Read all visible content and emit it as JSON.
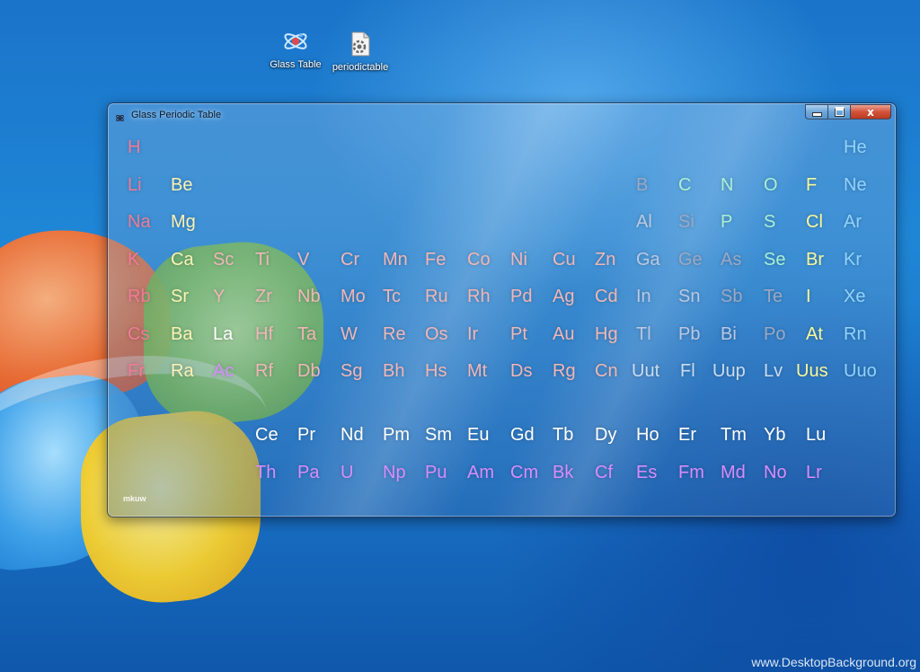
{
  "desktop": {
    "icons": [
      {
        "label": "Glass Table"
      },
      {
        "label": "periodictable"
      }
    ],
    "watermark": "www.DesktopBackground.org"
  },
  "window": {
    "title": "Glass Periodic Table",
    "minimize_symbol": "",
    "close_symbol": "x",
    "footer_mark": "mkuw"
  },
  "colors": {
    "alkali": "#f07a96",
    "alkaline_earth": "#f9f2b4",
    "transition": "#f0b6b6",
    "noble_gas": "#8fd3ff",
    "actinide": "#d78cff",
    "lanthanide": "#ffffff",
    "close_button": "#d2533a"
  },
  "elements": {
    "H": "H",
    "He": "He",
    "Li": "Li",
    "Be": "Be",
    "B": "B",
    "C": "C",
    "N": "N",
    "O": "O",
    "F": "F",
    "Ne": "Ne",
    "Na": "Na",
    "Mg": "Mg",
    "Al": "Al",
    "Si": "Si",
    "P": "P",
    "S": "S",
    "Cl": "Cl",
    "Ar": "Ar",
    "K": "K",
    "Ca": "Ca",
    "Sc": "Sc",
    "Ti": "Ti",
    "V": "V",
    "Cr": "Cr",
    "Mn": "Mn",
    "Fe": "Fe",
    "Co": "Co",
    "Ni": "Ni",
    "Cu": "Cu",
    "Zn": "Zn",
    "Ga": "Ga",
    "Ge": "Ge",
    "As": "As",
    "Se": "Se",
    "Br": "Br",
    "Kr": "Kr",
    "Rb": "Rb",
    "Sr": "Sr",
    "Y": "Y",
    "Zr": "Zr",
    "Nb": "Nb",
    "Mo": "Mo",
    "Tc": "Tc",
    "Ru": "Ru",
    "Rh": "Rh",
    "Pd": "Pd",
    "Ag": "Ag",
    "Cd": "Cd",
    "In": "In",
    "Sn": "Sn",
    "Sb": "Sb",
    "Te": "Te",
    "I": "I",
    "Xe": "Xe",
    "Cs": "Cs",
    "Ba": "Ba",
    "La": "La",
    "Hf": "Hf",
    "Ta": "Ta",
    "W": "W",
    "Re": "Re",
    "Os": "Os",
    "Ir": "Ir",
    "Pt": "Pt",
    "Au": "Au",
    "Hg": "Hg",
    "Tl": "Tl",
    "Pb": "Pb",
    "Bi": "Bi",
    "Po": "Po",
    "At": "At",
    "Rn": "Rn",
    "Fr": "Fr",
    "Ra": "Ra",
    "Ac": "Ac",
    "Rf": "Rf",
    "Db": "Db",
    "Sg": "Sg",
    "Bh": "Bh",
    "Hs": "Hs",
    "Mt": "Mt",
    "Ds": "Ds",
    "Rg": "Rg",
    "Cn": "Cn",
    "Uut": "Uut",
    "Fl": "Fl",
    "Uup": "Uup",
    "Lv": "Lv",
    "Uus": "Uus",
    "Uuo": "Uuo",
    "Ce": "Ce",
    "Pr": "Pr",
    "Nd": "Nd",
    "Pm": "Pm",
    "Sm": "Sm",
    "Eu": "Eu",
    "Gd": "Gd",
    "Tb": "Tb",
    "Dy": "Dy",
    "Ho": "Ho",
    "Er": "Er",
    "Tm": "Tm",
    "Yb": "Yb",
    "Lu": "Lu",
    "Th": "Th",
    "Pa": "Pa",
    "U": "U",
    "Np": "Np",
    "Pu": "Pu",
    "Am": "Am",
    "Cm": "Cm",
    "Bk": "Bk",
    "Cf": "Cf",
    "Es": "Es",
    "Fm": "Fm",
    "Md": "Md",
    "No": "No",
    "Lr": "Lr"
  }
}
